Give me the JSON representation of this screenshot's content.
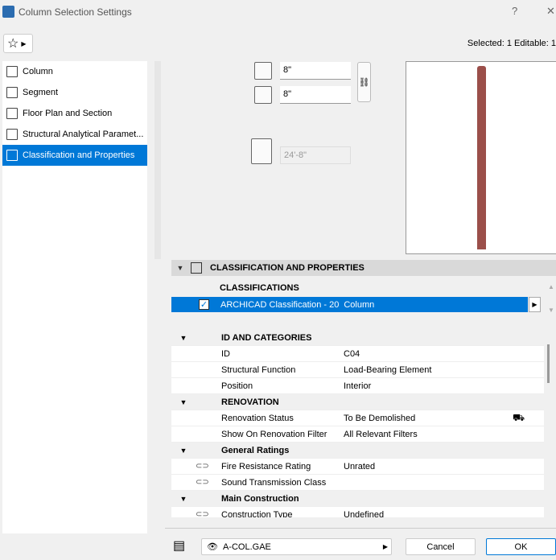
{
  "window": {
    "title": "Column Selection Settings",
    "help": "?",
    "close": "✕"
  },
  "selection_info": "Selected: 1 Editable: 1",
  "sidebar": {
    "items": [
      {
        "label": "Column"
      },
      {
        "label": "Segment"
      },
      {
        "label": "Floor Plan and Section"
      },
      {
        "label": "Structural Analytical Paramet..."
      },
      {
        "label": "Classification and Properties",
        "active": true
      }
    ]
  },
  "geometry": {
    "width": "8\"",
    "depth": "8\"",
    "height": "24'-8\""
  },
  "colors": {
    "accent": "#0078d7",
    "column": "#9b4f4a"
  },
  "section": {
    "title": "CLASSIFICATION AND PROPERTIES"
  },
  "classifications": {
    "header": "CLASSIFICATIONS",
    "row": {
      "system": "ARCHICAD Classification - 20",
      "value": "Column",
      "checked": true
    }
  },
  "properties": [
    {
      "group": "ID AND CATEGORIES"
    },
    {
      "name": "ID",
      "value": "C04"
    },
    {
      "name": "Structural Function",
      "value": "Load-Bearing Element"
    },
    {
      "name": "Position",
      "value": "Interior"
    },
    {
      "group": "RENOVATION"
    },
    {
      "name": "Renovation Status",
      "value": "To Be Demolished"
    },
    {
      "name": "Show On Renovation Filter",
      "value": "All Relevant Filters"
    },
    {
      "group": "General Ratings"
    },
    {
      "name": "Fire Resistance Rating",
      "value": "Unrated",
      "linked": true
    },
    {
      "name": "Sound Transmission Class",
      "value": "",
      "linked": true
    },
    {
      "group": "Main Construction"
    },
    {
      "name": "Construction Type",
      "value": "Undefined",
      "linked": true
    }
  ],
  "footer": {
    "layer": "A-COL.GAE",
    "cancel": "Cancel",
    "ok": "OK"
  }
}
